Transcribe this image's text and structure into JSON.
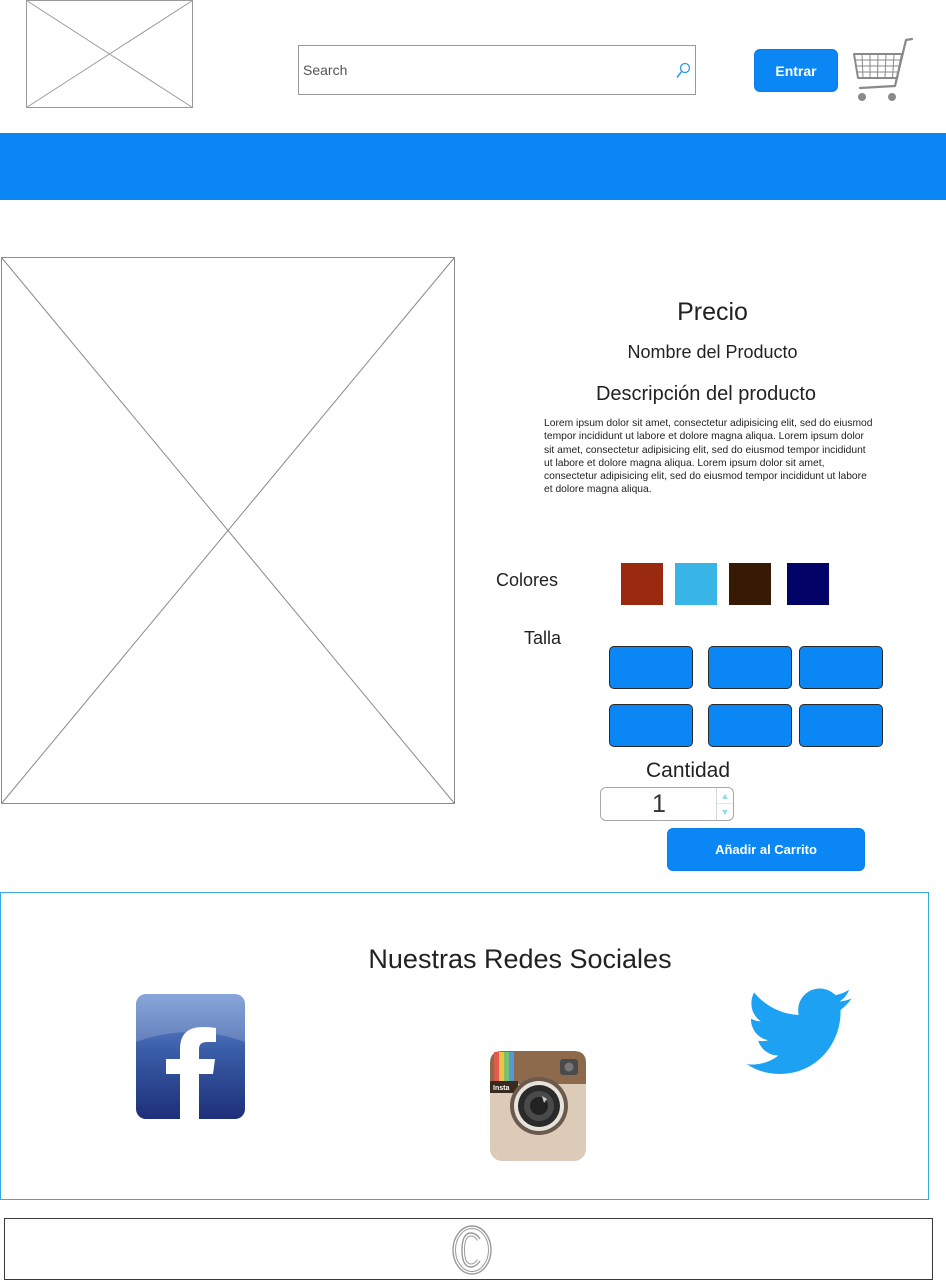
{
  "header": {
    "search": {
      "placeholder": "Search",
      "value": ""
    },
    "login_label": "Entrar"
  },
  "product": {
    "price_label": "Precio",
    "name_label": "Nombre del Producto",
    "description_title": "Descripción del producto",
    "description_text": "Lorem ipsum dolor sit amet, consectetur adipisicing elit, sed do eiusmod tempor incididunt ut labore et dolore magna aliqua. Lorem ipsum dolor sit amet, consectetur adipisicing elit, sed do eiusmod tempor incididunt ut labore et dolore magna aliqua. Lorem ipsum dolor sit amet, consectetur adipisicing elit, sed do eiusmod tempor incididunt ut labore et dolore magna aliqua.",
    "colors_label": "Colores",
    "colors": [
      "#992a10",
      "#38b4e6",
      "#361a06",
      "#030266"
    ],
    "size_label": "Talla",
    "quantity_label": "Cantidad",
    "quantity_value": "1",
    "add_to_cart_label": "Añadir al Carrito"
  },
  "social": {
    "title": "Nuestras Redes Sociales",
    "icons": [
      "facebook-icon",
      "instagram-icon",
      "twitter-icon"
    ],
    "instagram_badge": "Insta"
  },
  "footer": {
    "icon": "copyright-icon"
  },
  "theme": {
    "accent": "#0a86f5"
  }
}
